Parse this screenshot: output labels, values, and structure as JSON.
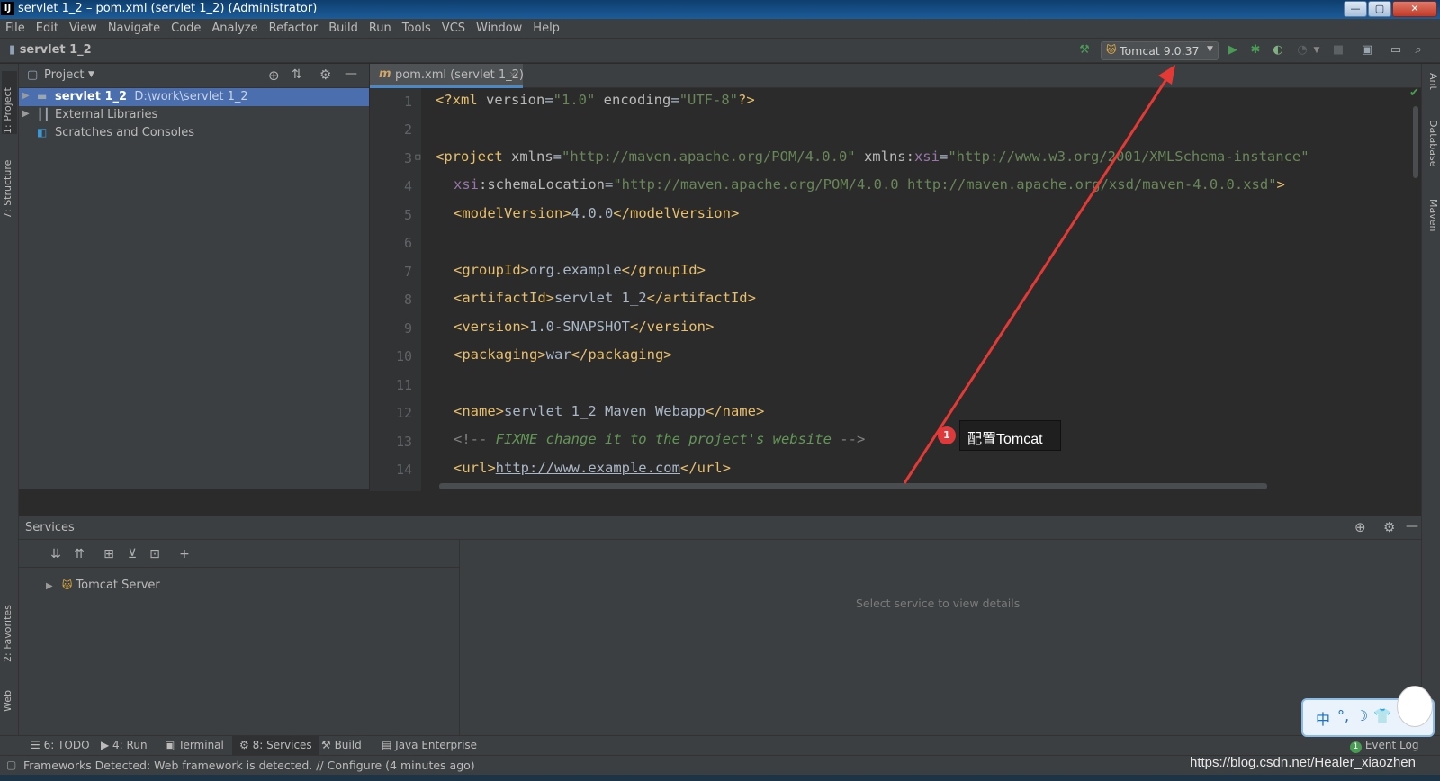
{
  "window": {
    "title": "servlet 1_2 – pom.xml (servlet 1_2) (Administrator)",
    "app_icon": "IJ",
    "controls": {
      "minimize": "—",
      "maximize": "▢",
      "close": "✕"
    }
  },
  "menu": [
    "File",
    "Edit",
    "View",
    "Navigate",
    "Code",
    "Analyze",
    "Refactor",
    "Build",
    "Run",
    "Tools",
    "VCS",
    "Window",
    "Help"
  ],
  "navbar": {
    "project": "servlet 1_2",
    "run_config": "Tomcat 9.0.37"
  },
  "left_stripe": {
    "project_tab": "1: Project",
    "structure_tab": "7: Structure",
    "favorites_tab": "2: Favorites",
    "web_tab": "Web"
  },
  "right_stripe": {
    "ant_tab": "Ant",
    "database_tab": "Database",
    "maven_tab": "Maven"
  },
  "project_panel": {
    "title": "Project",
    "tree": [
      {
        "label": "servlet 1_2",
        "path": "D:\\work\\servlet 1_2",
        "selected": true
      },
      {
        "label": "External Libraries",
        "path": ""
      },
      {
        "label": "Scratches and Consoles",
        "path": ""
      }
    ]
  },
  "editor": {
    "tab": {
      "icon": "m",
      "label": "pom.xml (servlet 1_2)",
      "close": "×"
    },
    "line_numbers": [
      "1",
      "2",
      "3",
      "4",
      "5",
      "6",
      "7",
      "8",
      "9",
      "10",
      "11",
      "12",
      "13",
      "14"
    ],
    "lines": {
      "l1": {
        "a": "<?xml ",
        "b": "version",
        "c": "=",
        "d": "\"1.0\"",
        "e": " encoding",
        "f": "=",
        "g": "\"UTF-8\"",
        "h": "?>"
      },
      "l3": {
        "open": "<project ",
        "xmlns": "xmlns",
        "eq1": "=",
        "v1": "\"http://maven.apache.org/POM/4.0.0\"",
        "sp": " xmlns:",
        "xsi": "xsi",
        "eq2": "=",
        "v2": "\"http://www.w3.org/2001/XMLSchema-instance\""
      },
      "l4": {
        "xsi": "xsi",
        "attr": ":schemaLocation",
        "eq": "=",
        "v": "\"http://maven.apache.org/POM/4.0.0 http://maven.apache.org/xsd/maven-4.0.0.xsd\"",
        "close": ">"
      },
      "l5": {
        "open": "<modelVersion>",
        "text": "4.0.0",
        "close": "</modelVersion>"
      },
      "l7": {
        "open": "<groupId>",
        "text": "org.example",
        "close": "</groupId>"
      },
      "l8": {
        "open": "<artifactId>",
        "text": "servlet 1_2",
        "close": "</artifactId>"
      },
      "l9": {
        "open": "<version>",
        "text": "1.0-SNAPSHOT",
        "close": "</version>"
      },
      "l10": {
        "open": "<packaging>",
        "text": "war",
        "close": "</packaging>"
      },
      "l12": {
        "open": "<name>",
        "text": "servlet 1_2 Maven Webapp",
        "close": "</name>"
      },
      "l13": {
        "a": "<!-- ",
        "text": "FIXME change it to the project's website",
        "b": " -->"
      },
      "l14": {
        "open": "<url>",
        "text": "http://www.example.com",
        "close": "</url>"
      }
    }
  },
  "services": {
    "title": "Services",
    "tree_item": "Tomcat Server",
    "empty_hint": "Select service to view details"
  },
  "tool_tabs": [
    {
      "label": "6: TODO"
    },
    {
      "label": "4: Run"
    },
    {
      "label": "Terminal"
    },
    {
      "label": "8: Services",
      "active": true
    },
    {
      "label": "Build"
    },
    {
      "label": "Java Enterprise"
    }
  ],
  "event_log": {
    "count": "1",
    "label": "Event Log"
  },
  "status": "Frameworks Detected: Web framework is detected. // Configure (4 minutes ago)",
  "watermark": "https://blog.csdn.net/Healer_xiaozhen",
  "annotation": {
    "badge": "1",
    "text": "配置Tomcat"
  },
  "ime": {
    "keys": [
      "中",
      "°,",
      "☽",
      "👕"
    ]
  },
  "colors": {
    "accent": "#4a88c7",
    "selection": "#4b6eaf",
    "run_green": "#499c54",
    "annotation_red": "#e0393b",
    "xml_tag": "#e8bf6a",
    "xml_string": "#6a8759"
  }
}
